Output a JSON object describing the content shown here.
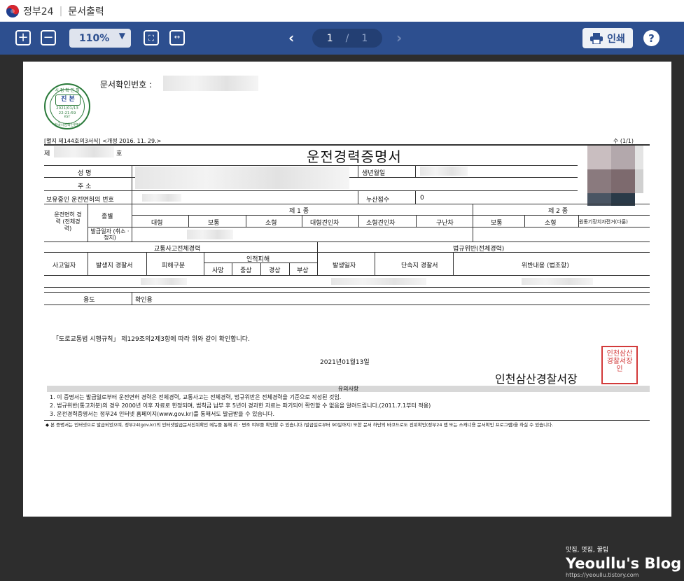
{
  "window": {
    "brand": "정부24",
    "separator": "|",
    "title": "문서출력"
  },
  "toolbar": {
    "zoom_in": "+",
    "zoom_out": "−",
    "zoom_value": "110%",
    "page_current": "1",
    "page_sep": "/",
    "page_total": "1",
    "print_label": "인쇄",
    "help_label": "?"
  },
  "doc": {
    "docnum_label": "문서확인번호 :",
    "seal": {
      "top": "시 점 확 인 필",
      "center": "진 본",
      "date": "2021/01/13",
      "time": "22:21:59",
      "tz": "KST",
      "issuer": "한국시점확인센터"
    },
    "form_ref": "[별지 제144호의3서식] <개정 2016. 11. 29.>",
    "page_count": "수 (1/1)",
    "no_label": "제",
    "ho_label": "호",
    "title": "운전경력증명서",
    "name_label": "성    명",
    "address_label": "주    소",
    "license_label": "보유중인 운전면허의 번호",
    "birth_label": "생년월일",
    "points_label": "누산점수",
    "points_value": "0",
    "history_label": "운전면허 경력 (전체경력)",
    "class_label": "종별",
    "issue_label": "발급일자 (취소 · 정지)",
    "class1": "제 1 종",
    "class2": "제 2 종",
    "class1_items": [
      "대형",
      "보통",
      "소형",
      "대형견인차",
      "소형견인차",
      "구난차"
    ],
    "class2_items": [
      "보통",
      "소형",
      "원동기장치자전거(다륜)"
    ],
    "accident_head": "교통사고전체경력",
    "violation_head": "법규위반(전체경력)",
    "accident_cols": [
      "사고일자",
      "발생지 경찰서",
      "피해구분"
    ],
    "injury_head": "인적피해",
    "injury_cols": [
      "사망",
      "중상",
      "경상",
      "부상"
    ],
    "violation_cols": [
      "발생일자",
      "단속지 경찰서",
      "위반내용 (법조항)"
    ],
    "purpose_label": "용도",
    "purpose_value": "확인용",
    "statement": "「도로교통법 시행규칙」 제129조의2제3항에 따라 위와 같이 확인합니다.",
    "date": "2021년01월13일",
    "issuer": "인천삼산경찰서장",
    "seal_text": "인천삼산경찰서장인",
    "notes_head": "유의사항",
    "notes": [
      "1. 이 증명서는 발급일로부터 운전면허 경력은 전체경력, 교통사고는 전체경력, 법규위반은 전체경력을 기준으로 작성된 것임.",
      "2. 법규위반(통고처분)의 경우 2000년 이후 자료로  한정되며, 범칙금 납부 후 5년이 경과한 자료는 파기되어 확인할 수 없음을 알려드립니다.(2011.7.1부터 적용)",
      "3. 운전경력증명서는 정부24 인터넷 홈페이지(www.gov.kr)를 통해서도 발급받을 수 있습니다."
    ],
    "footer_note": "◆ 본 증명서는 인터넷으로 발급되었으며, 정부24(gov.kr)의 인터넷발급문서진위확인 메뉴를 통해 위 · 변조 여부를 확인할 수 있습니다.(발급일로부터 90일까지) 또한 문서 하단의 바코드로도 진위확인(정부24 앱 또는 스캐너용 문서확인 프로그램)을 하실 수 있습니다."
  },
  "watermark": {
    "tagline": "맛집, 멋집, 꿀팁",
    "name": "Yeoullu's Blog",
    "url": "https://yeoullu.tistory.com"
  },
  "colors": {
    "toolbar": "#2d4f8f",
    "background": "#2d2d2d",
    "seal_green": "#2a7a3a",
    "seal_red": "#d23a3a"
  }
}
